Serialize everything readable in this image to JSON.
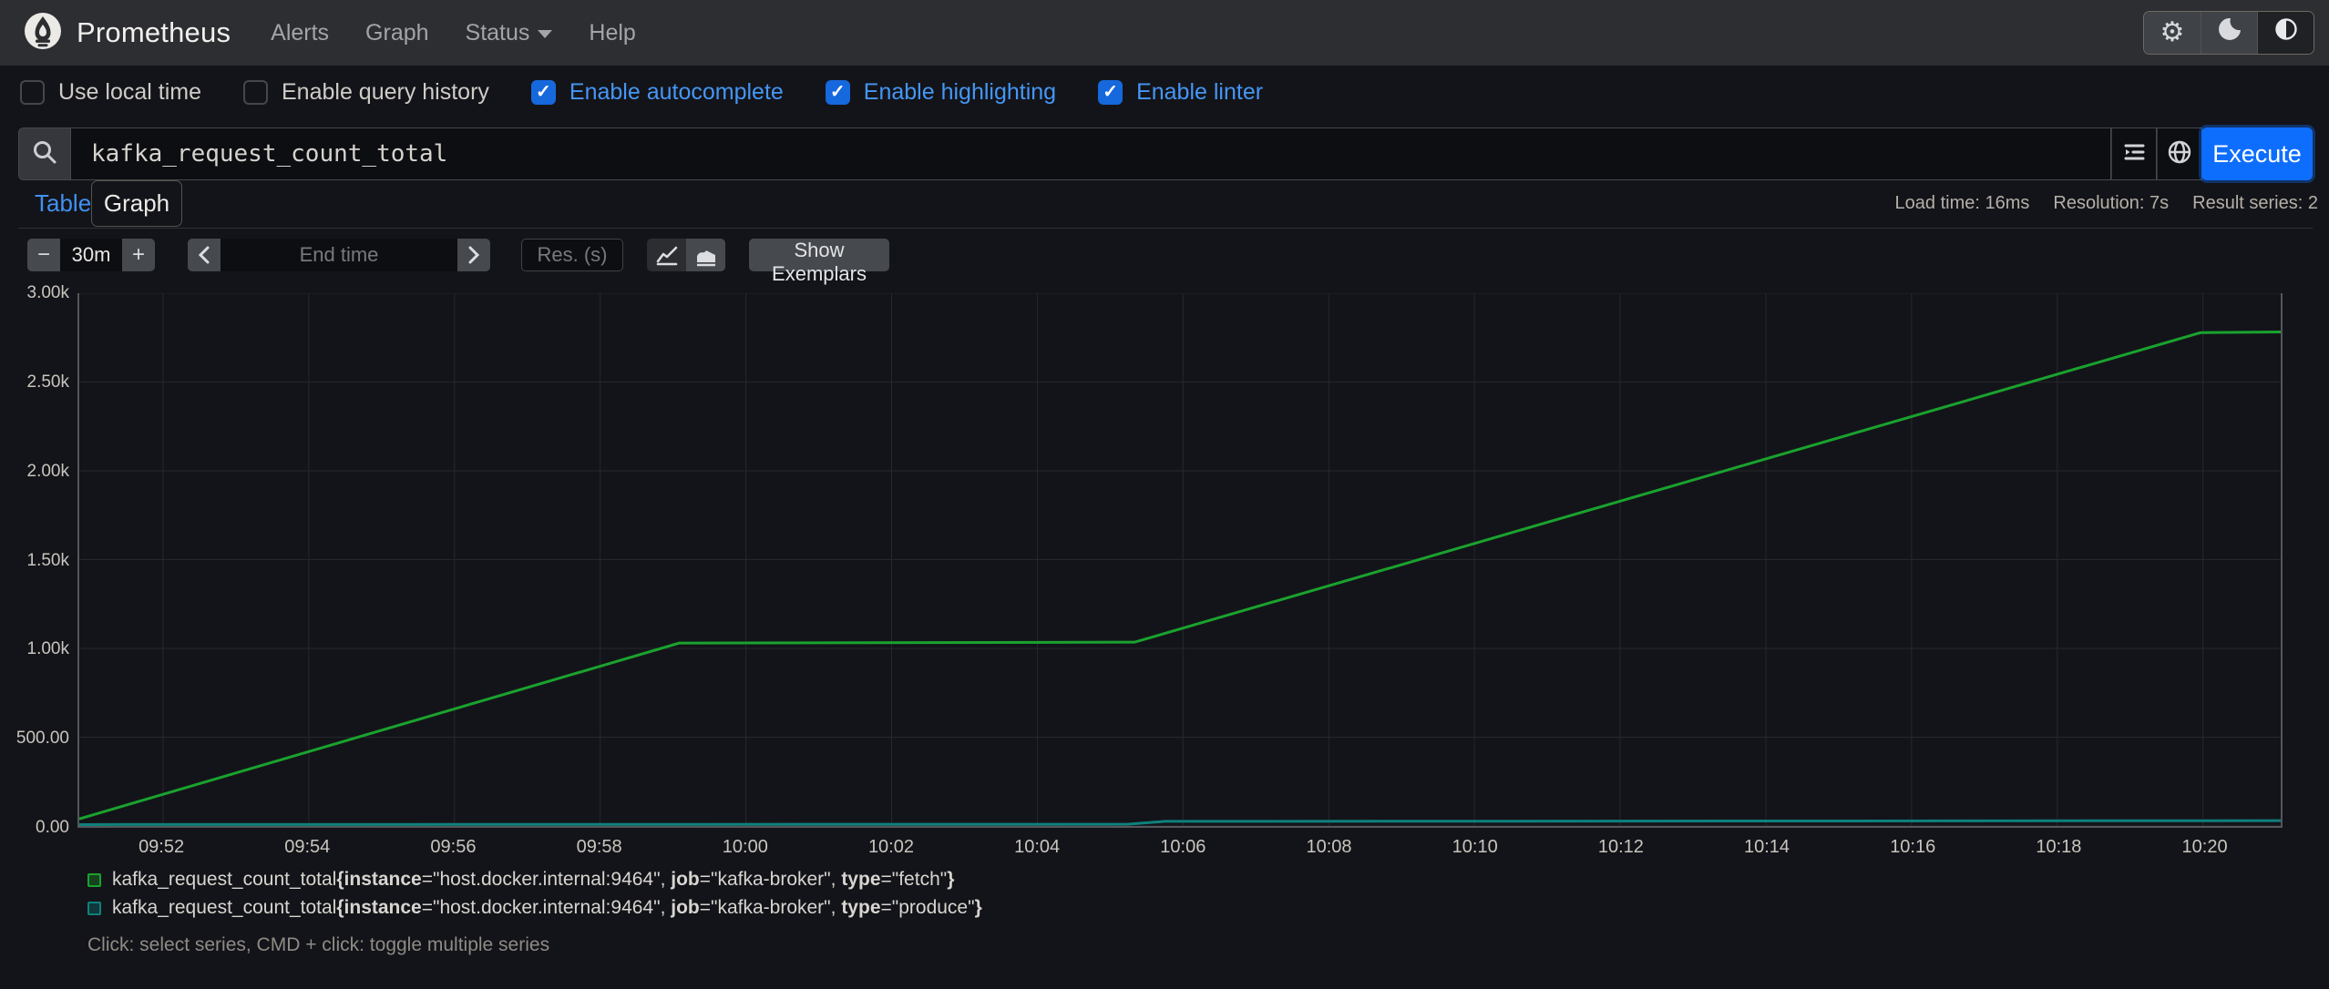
{
  "navbar": {
    "title": "Prometheus",
    "links": [
      {
        "label": "Alerts",
        "caret": false
      },
      {
        "label": "Graph",
        "caret": false
      },
      {
        "label": "Status",
        "caret": true
      },
      {
        "label": "Help",
        "caret": false
      }
    ],
    "theme_buttons": [
      {
        "name": "gear-icon",
        "active": false
      },
      {
        "name": "moon-icon",
        "active": false
      },
      {
        "name": "half-circle-icon",
        "active": true
      }
    ]
  },
  "options": {
    "checkboxes": [
      {
        "label": "Use local time",
        "checked": false
      },
      {
        "label": "Enable query history",
        "checked": false
      },
      {
        "label": "Enable autocomplete",
        "checked": true
      },
      {
        "label": "Enable highlighting",
        "checked": true
      },
      {
        "label": "Enable linter",
        "checked": true
      }
    ]
  },
  "query": {
    "value": "kafka_request_count_total",
    "execute_label": "Execute"
  },
  "tabs": {
    "inactive_label": "Table",
    "active_label": "Graph"
  },
  "stats": [
    "Load time: 16ms",
    "Resolution: 7s",
    "Result series: 2"
  ],
  "controls": {
    "minus_label": "−",
    "plus_label": "+",
    "range_value": "30m",
    "end_time_placeholder": "End time",
    "resolution_placeholder": "Res. (s)",
    "show_exemplars_label": "Show Exemplars"
  },
  "chart_data": {
    "type": "line",
    "title": "",
    "xlabel": "",
    "ylabel": "",
    "grid": true,
    "legend_position": "bottom",
    "x_range": [
      "09:50:51",
      "10:21:04"
    ],
    "x_ticks": [
      "09:52",
      "09:54",
      "09:56",
      "09:58",
      "10:00",
      "10:02",
      "10:04",
      "10:06",
      "10:08",
      "10:10",
      "10:12",
      "10:14",
      "10:16",
      "10:18",
      "10:20"
    ],
    "ylim": [
      0,
      3000
    ],
    "y_ticks": [
      {
        "label": "0.00",
        "value": 0
      },
      {
        "label": "500.00",
        "value": 500
      },
      {
        "label": "1.00k",
        "value": 1000
      },
      {
        "label": "1.50k",
        "value": 1500
      },
      {
        "label": "2.00k",
        "value": 2000
      },
      {
        "label": "2.50k",
        "value": 2500
      },
      {
        "label": "3.00k",
        "value": 3000
      }
    ],
    "series": [
      {
        "name": "kafka_request_count_total{instance=\"host.docker.internal:9464\", job=\"kafka-broker\", type=\"fetch\"}",
        "color": "#1aa22e",
        "points": [
          [
            "09:50:51",
            40
          ],
          [
            "09:59:05",
            1030
          ],
          [
            "10:05:20",
            1035
          ],
          [
            "10:19:58",
            2778
          ],
          [
            "10:21:04",
            2782
          ]
        ]
      },
      {
        "name": "kafka_request_count_total{instance=\"host.docker.internal:9464\", job=\"kafka-broker\", type=\"produce\"}",
        "color": "#0e817d",
        "points": [
          [
            "09:50:51",
            8
          ],
          [
            "10:05:15",
            10
          ],
          [
            "10:05:45",
            26
          ],
          [
            "10:21:04",
            30
          ]
        ]
      }
    ]
  },
  "legend": {
    "items": [
      {
        "color": "#1aa22e",
        "metric": "kafka_request_count_total",
        "labels": [
          {
            "key": "instance",
            "value": "host.docker.internal:9464"
          },
          {
            "key": "job",
            "value": "kafka-broker"
          },
          {
            "key": "type",
            "value": "fetch"
          }
        ]
      },
      {
        "color": "#0e817d",
        "metric": "kafka_request_count_total",
        "labels": [
          {
            "key": "instance",
            "value": "host.docker.internal:9464"
          },
          {
            "key": "job",
            "value": "kafka-broker"
          },
          {
            "key": "type",
            "value": "produce"
          }
        ]
      }
    ],
    "hint": "Click: select series, CMD + click: toggle multiple series"
  }
}
